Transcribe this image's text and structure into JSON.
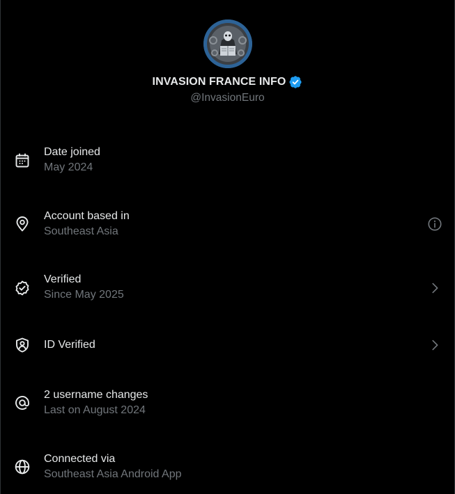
{
  "profile": {
    "display_name": "INVASION FRANCE INFO",
    "handle": "@InvasionEuro",
    "badge_color": "#1d9bf0",
    "avatar_icon": "avatar-image"
  },
  "items": [
    {
      "icon": "calendar-icon",
      "title": "Date joined",
      "subtitle": "May 2024",
      "right_icon": ""
    },
    {
      "icon": "location-pin-icon",
      "title": "Account based in",
      "subtitle": "Southeast Asia",
      "right_icon": "info-icon"
    },
    {
      "icon": "verified-check-icon",
      "title": "Verified",
      "subtitle": "Since May 2025",
      "right_icon": "chevron-right-icon"
    },
    {
      "icon": "id-shield-icon",
      "title": "ID Verified",
      "subtitle": "",
      "right_icon": "chevron-right-icon"
    },
    {
      "icon": "at-sign-icon",
      "title": "2 username changes",
      "subtitle": "Last on August 2024",
      "right_icon": ""
    },
    {
      "icon": "globe-icon",
      "title": "Connected via",
      "subtitle": "Southeast Asia Android App",
      "right_icon": ""
    }
  ],
  "colors": {
    "background": "#000000",
    "primary_text": "#e7e9ea",
    "secondary_text": "#71767b",
    "accent": "#1d9bf0"
  }
}
